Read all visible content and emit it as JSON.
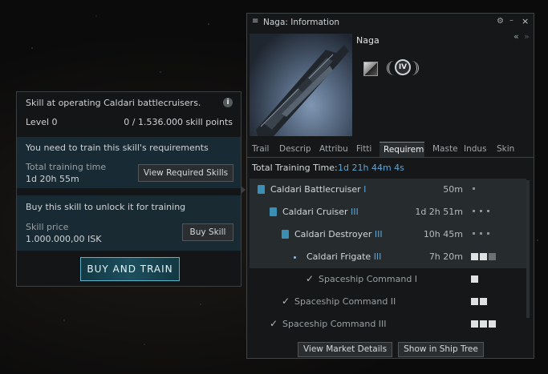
{
  "tooltip": {
    "description": "Skill at operating Caldari battlecruisers.",
    "level": "Level 0",
    "skill_points": "0 / 1.536.000 skill points",
    "requirements_heading": "You need to train this skill's requirements",
    "training_label": "Total training time",
    "training_value": "1d 20h 55m",
    "view_button": "View Required Skills",
    "buy_heading": "Buy this skill to unlock it for training",
    "price_label": "Skill price",
    "price_value": "1.000.000,00 ISK",
    "buy_button": "Buy Skill",
    "buy_train_button": "BUY AND TRAIN"
  },
  "window": {
    "title": "Naga: Information",
    "ship_name": "Naga",
    "tech_badge": "IV",
    "tabs": [
      "Trail",
      "Descrip",
      "Attribu",
      "Fitti",
      "Requireme",
      "Maste",
      "Indus",
      "Skin"
    ],
    "active_tab": "Requireme",
    "total_label": "Total Training Time:",
    "total_value": "1d 21h 44m 4s",
    "skills": [
      {
        "name": "Caldari Battlecruiser",
        "level": "I",
        "time": "50m"
      },
      {
        "name": "Caldari Cruiser",
        "level": "III",
        "time": "1d 2h 51m"
      },
      {
        "name": "Caldari Destroyer",
        "level": "III",
        "time": "10h 45m"
      },
      {
        "name": "Caldari Frigate",
        "level": "III",
        "time": "7h 20m"
      },
      {
        "name": "Spaceship Command",
        "level": "I",
        "time": ""
      },
      {
        "name": "Spaceship Command",
        "level": "II",
        "time": ""
      },
      {
        "name": "Spaceship Command",
        "level": "III",
        "time": ""
      }
    ],
    "market_button": "View Market Details",
    "shiptree_button": "Show in Ship Tree"
  }
}
